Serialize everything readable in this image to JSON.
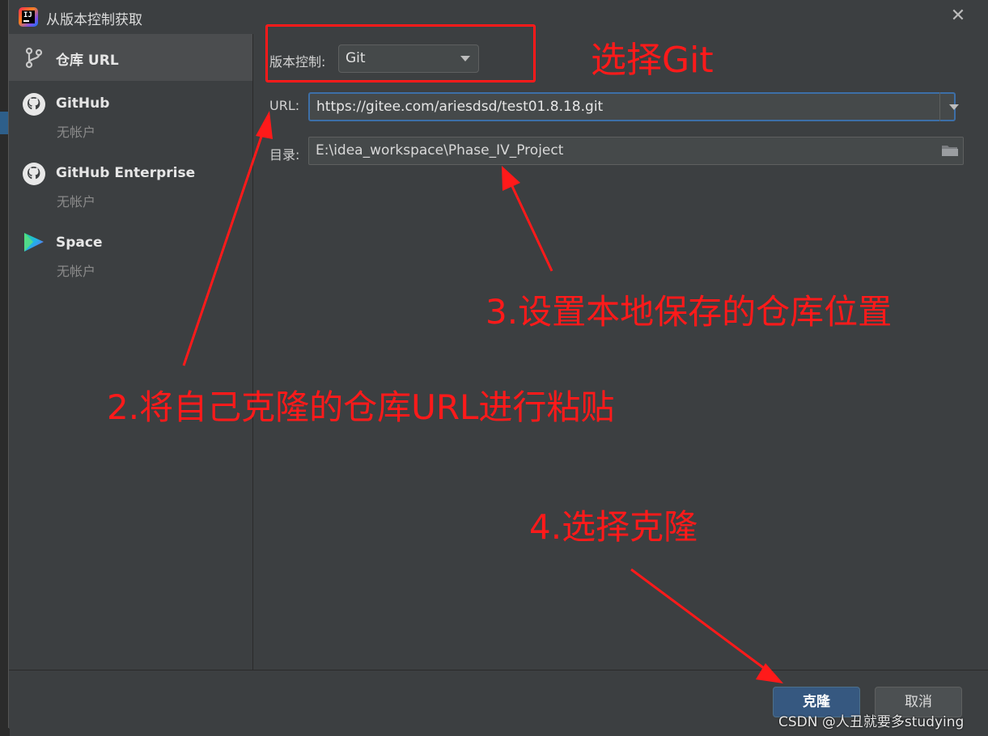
{
  "window": {
    "title": "从版本控制获取"
  },
  "nav": {
    "items": [
      {
        "label": "仓库 URL",
        "sub": "",
        "icon": "vcs-branch-icon",
        "selected": true
      },
      {
        "label": "GitHub",
        "sub": "无帐户",
        "icon": "github-icon",
        "selected": false
      },
      {
        "label": "GitHub Enterprise",
        "sub": "无帐户",
        "icon": "github-icon",
        "selected": false
      },
      {
        "label": "Space",
        "sub": "无帐户",
        "icon": "space-icon",
        "selected": false
      }
    ]
  },
  "form": {
    "vcs_label": "版本控制:",
    "vcs_value": "Git",
    "url_label": "URL:",
    "url_value": "https://gitee.com/ariesdsd/test01.8.18.git",
    "dir_label": "目录:",
    "dir_value": "E:\\idea_workspace\\Phase_IV_Project"
  },
  "footer": {
    "clone_label": "克隆",
    "cancel_label": "取消"
  },
  "annotations": {
    "select_git": "选择Git",
    "step2": "2.将自己克隆的仓库URL进行粘贴",
    "step3": "3.设置本地保存的仓库位置",
    "step4": "4.选择克隆"
  },
  "watermark": "CSDN @人丑就要多studying",
  "colors": {
    "annotation": "#ff1a1a",
    "primary_button": "#365880",
    "focus_border": "#3d6fa8"
  }
}
